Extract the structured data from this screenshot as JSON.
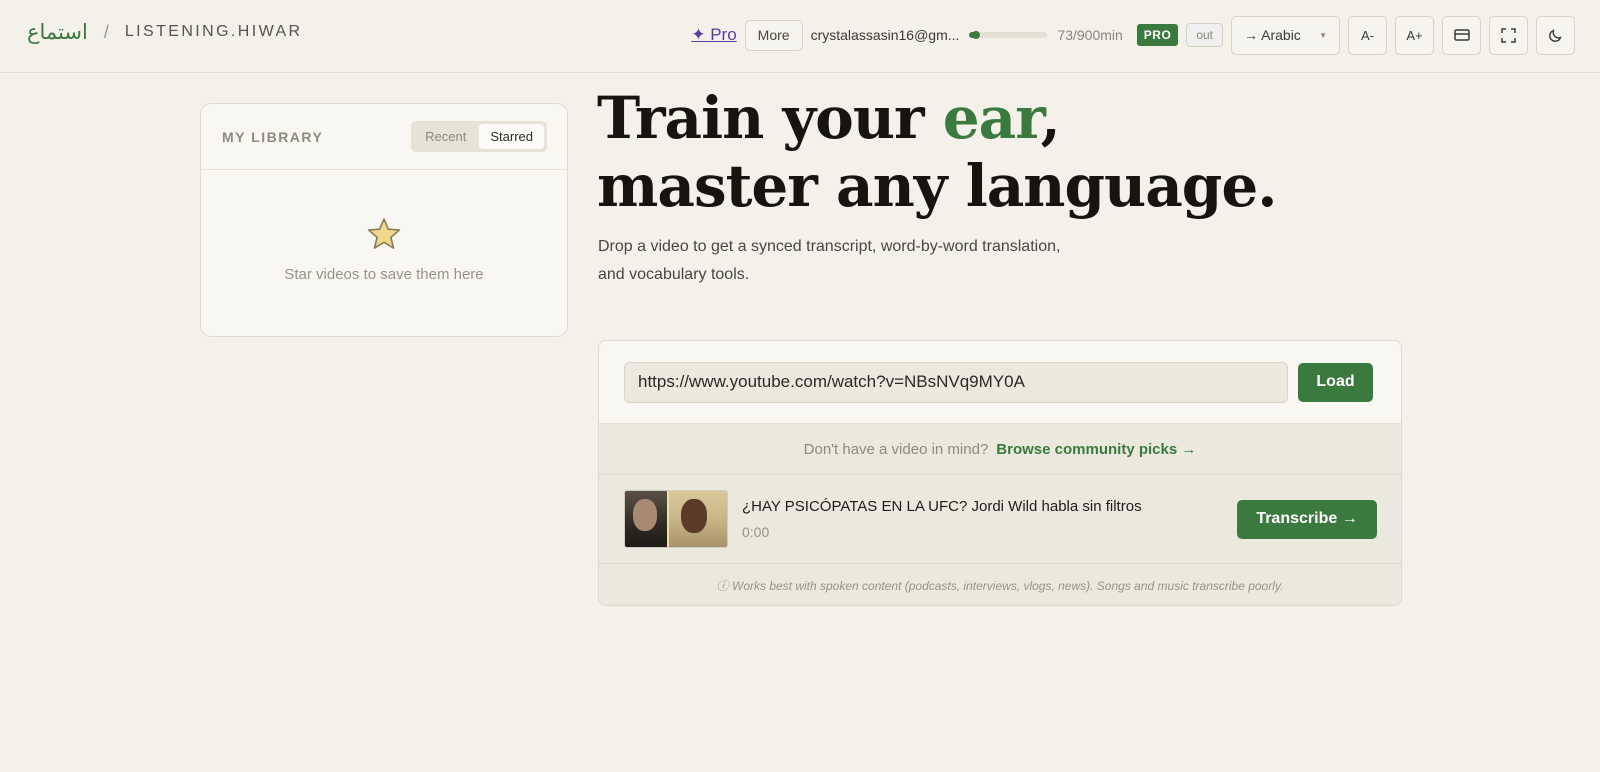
{
  "header": {
    "brand_arabic": "استماع",
    "brand_separator": "/",
    "brand_name": "LISTENING.HIWAR",
    "pro_link": "✦ Pro",
    "more_label": "More",
    "email": "crystalassasin16@gm...",
    "usage_text": "73/900min",
    "usage_fraction": 0.081,
    "pro_badge": "PRO",
    "logout_label": "out",
    "language_select": "→ Arabic",
    "font_decrease": "A-",
    "font_increase": "A+",
    "icons": [
      "subtitle-icon",
      "fullscreen-icon",
      "moon-icon"
    ]
  },
  "library": {
    "title": "MY LIBRARY",
    "tabs": [
      {
        "label": "Recent",
        "active": false
      },
      {
        "label": "Starred",
        "active": true
      }
    ],
    "empty_icon": "star-icon",
    "empty_text": "Star videos to save them here"
  },
  "hero": {
    "title_part1": "Train your ",
    "title_accent": "ear",
    "title_part2": ",",
    "title_line2": "master any language.",
    "subtitle": "Drop a video to get a synced transcript, word-by-word translation, and vocabulary tools."
  },
  "loader": {
    "url_value": "https://www.youtube.com/watch?v=NBsNVq9MY0A",
    "load_label": "Load",
    "browse_question": "Don't have a video in mind?",
    "browse_link": "Browse community picks →",
    "video": {
      "title": "¿HAY PSICÓPATAS EN LA UFC? Jordi Wild habla sin filtros",
      "duration": "0:00",
      "action_label": "Transcribe →"
    },
    "note": "ⓘ Works best with spoken content (podcasts, interviews, vlogs, news). Songs and music transcribe poorly."
  },
  "colors": {
    "accent_green": "#3b7a3f",
    "pro_purple": "#5c3aa6",
    "background": "#f3f1ea"
  }
}
